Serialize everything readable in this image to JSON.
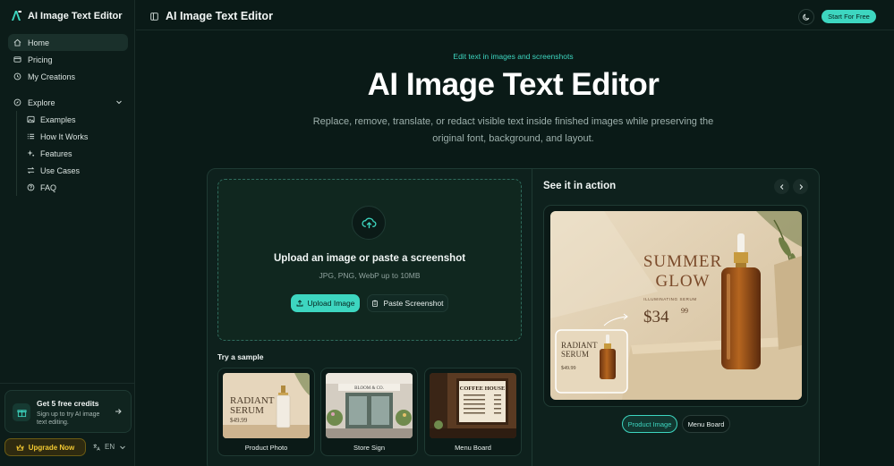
{
  "sidebar": {
    "brand": "AI Image Text Editor",
    "nav": [
      {
        "label": "Home",
        "icon": "home-icon"
      },
      {
        "label": "Pricing",
        "icon": "card-icon"
      },
      {
        "label": "My Creations",
        "icon": "history-icon"
      }
    ],
    "explore_label": "Explore",
    "explore_items": [
      {
        "label": "Examples",
        "icon": "image-icon"
      },
      {
        "label": "How It Works",
        "icon": "list-icon"
      },
      {
        "label": "Features",
        "icon": "sparkles-icon"
      },
      {
        "label": "Use Cases",
        "icon": "swap-icon"
      },
      {
        "label": "FAQ",
        "icon": "help-icon"
      }
    ],
    "credits_title": "Get 5 free credits",
    "credits_sub": "Sign up to try AI image text editing.",
    "upgrade_label": "Upgrade Now",
    "language": "EN"
  },
  "topbar": {
    "title": "AI Image Text Editor",
    "start_label": "Start For Free"
  },
  "hero": {
    "kicker": "Edit text in images and screenshots",
    "title": "AI Image Text Editor",
    "description": "Replace, remove, translate, or redact visible text inside finished images while preserving the original font, background, and layout."
  },
  "upload": {
    "title": "Upload an image or paste a screenshot",
    "formats": "JPG, PNG, WebP up to 10MB",
    "upload_label": "Upload Image",
    "paste_label": "Paste Screenshot"
  },
  "samples": {
    "label": "Try a sample",
    "items": [
      {
        "name": "Product Photo",
        "img_text_a": "RADIANT",
        "img_text_b": "SERUM",
        "img_price": "$49.99"
      },
      {
        "name": "Store Sign",
        "img_text_a": "BLOOM & CO."
      },
      {
        "name": "Menu Board",
        "img_text_a": "COFFEE HOUSE"
      }
    ]
  },
  "preview": {
    "title": "See it in action",
    "line1": "SUMMER",
    "line2": "GLOW",
    "line3": "ILLUMINATING SERUM",
    "price_main": "$34",
    "price_cents": "99",
    "inset_a": "RADIANT",
    "inset_b": "SERUM",
    "inset_price": "$49.99",
    "tabs": [
      "Product Image",
      "Menu Board"
    ]
  },
  "colors": {
    "accent": "#3dd6c0",
    "background": "#0a1a17",
    "upgrade": "#f2c832"
  }
}
